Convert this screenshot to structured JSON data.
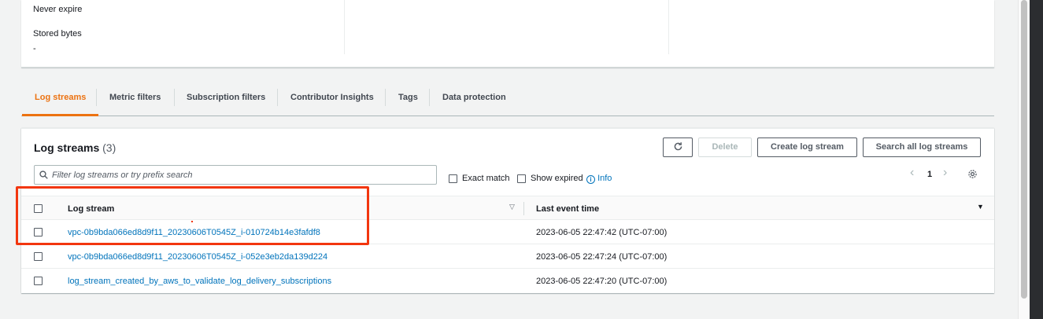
{
  "details": {
    "retention_value": "Never expire",
    "stored_bytes_label": "Stored bytes",
    "stored_bytes_value": "-"
  },
  "tabs": [
    {
      "label": "Log streams",
      "active": true
    },
    {
      "label": "Metric filters"
    },
    {
      "label": "Subscription filters"
    },
    {
      "label": "Contributor Insights"
    },
    {
      "label": "Tags"
    },
    {
      "label": "Data protection"
    }
  ],
  "streams_panel": {
    "title": "Log streams",
    "count": "(3)",
    "delete_label": "Delete",
    "create_label": "Create log stream",
    "search_all_label": "Search all log streams",
    "filter_placeholder": "Filter log streams or try prefix search",
    "exact_match_label": "Exact match",
    "show_expired_label": "Show expired",
    "info_label": "Info",
    "page_number": "1"
  },
  "table": {
    "columns": [
      "Log stream",
      "Last event time"
    ],
    "rows": [
      {
        "name": "vpc-0b9bda066ed8d9f11_20230606T0545Z_i-010724b14e3fafdf8",
        "time": "2023-06-05 22:47:42 (UTC-07:00)"
      },
      {
        "name": "vpc-0b9bda066ed8d9f11_20230606T0545Z_i-052e3eb2da139d224",
        "time": "2023-06-05 22:47:24 (UTC-07:00)"
      },
      {
        "name": "log_stream_created_by_aws_to_validate_log_delivery_subscriptions",
        "time": "2023-06-05 22:47:20 (UTC-07:00)"
      }
    ]
  },
  "colors": {
    "accent": "#ec7211",
    "link": "#0073bb",
    "highlight": "#f2360f"
  }
}
